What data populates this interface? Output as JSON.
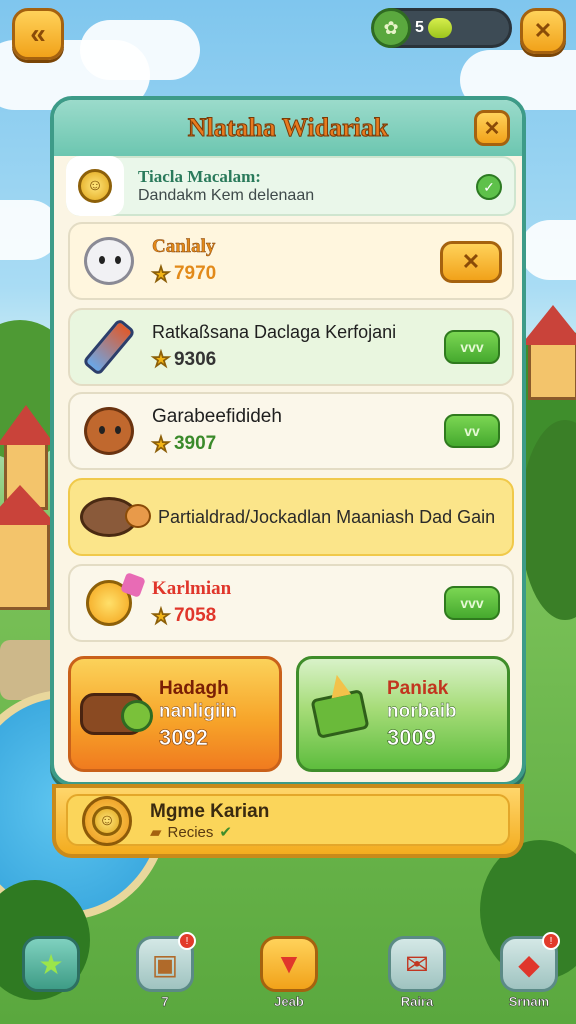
{
  "top_bar": {
    "back_icon": "back-arrow-icon",
    "energy_value": "5",
    "close_icon": "close-icon"
  },
  "panel": {
    "title": "Nlataha Widariak",
    "info": {
      "title": "Tiacla Macalam:",
      "subtitle": "Dandakm Kem delenaan"
    },
    "items": [
      {
        "name": "Canlaly",
        "price": "7970",
        "name_color": "#e28a1a",
        "action": "close",
        "action_label": "✕",
        "bg": "#fff6de"
      },
      {
        "name": "Ratkaßsana Daclaga Kerfojani",
        "price": "9306",
        "name_color": "#1f1f1f",
        "action": "confirm",
        "action_label": "vvv",
        "bg": "#e9f6df"
      },
      {
        "name": "Garabeefidideh",
        "price": "3907",
        "name_color": "#1f1f1f",
        "action": "confirm",
        "action_label": "vv",
        "bg": "#fbf7ea"
      },
      {
        "name": "Partialdrad/Jockadlan Maaniash Dad Gain",
        "price": "",
        "name_color": "#2a2a2a",
        "action": "none",
        "action_label": "",
        "bg": "#fbe58a"
      },
      {
        "name": "Karlmian",
        "price": "7058",
        "name_color": "#e0362b",
        "action": "confirm",
        "action_label": "vvv",
        "bg": "#fbf7ea"
      }
    ],
    "cards": [
      {
        "line1": "Hadagh",
        "line2": "nanligiin",
        "value": "3092"
      },
      {
        "line1": "Paniak",
        "line2": "norbaib",
        "value": "3009"
      }
    ]
  },
  "bottom_reward": {
    "title": "Mgme Karian",
    "subtitle": "Recies"
  },
  "nav": [
    {
      "label": "",
      "icon": "star-icon",
      "badge": ""
    },
    {
      "label": "7",
      "icon": "box-icon",
      "badge": "!"
    },
    {
      "label": "Jeab",
      "icon": "popcorn-icon",
      "badge": ""
    },
    {
      "label": "Raira",
      "icon": "gift-icon",
      "badge": ""
    },
    {
      "label": "Srnam",
      "icon": "car-icon",
      "badge": "!"
    }
  ],
  "colors": {
    "panel_border": "#3d9b88",
    "title_orange": "#e87b1f",
    "button_green": "#45a92e",
    "button_orange": "#f1a21a"
  }
}
